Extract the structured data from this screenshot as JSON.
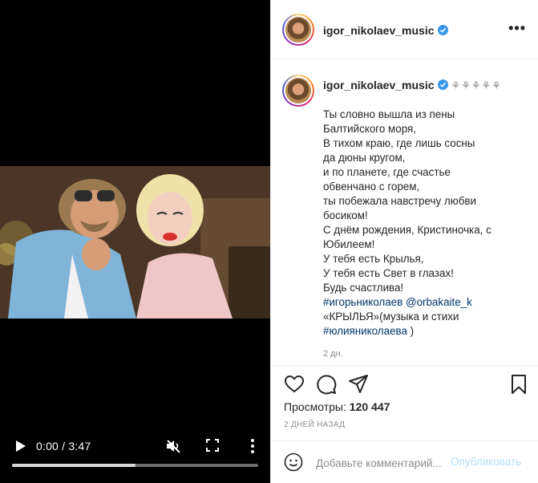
{
  "video": {
    "time_current": "0:00",
    "time_total": "3:47",
    "progress": 0.5,
    "icons": [
      "play-icon",
      "muted-speaker-icon",
      "fullscreen-icon",
      "more-vertical-icon"
    ]
  },
  "header": {
    "username": "igor_nikolaev_music",
    "more_label": "•••"
  },
  "post": {
    "username": "igor_nikolaev_music",
    "flowers": "⚘⚘⚘⚘⚘",
    "caption_lines": [
      "Ты словно вышла из пены",
      "Балтийского моря,",
      "В тихом краю, где лишь сосны",
      "да дюны кругом,",
      "и по планете, где счастье",
      "обвенчано с горем,",
      "ты побежала навстречу любви",
      "босиком!",
      "С днём рождения, Кристиночка, с",
      "Юбилеем!",
      "У тебя есть Крылья,",
      "У тебя есть Свет в глазах!",
      "Будь счастлива!"
    ],
    "hashtag_1": "#игорьниколаев",
    "mention": "@orbakaite_k",
    "credits_text": "«КРЫЛЬЯ»(музыка и стихи",
    "hashtag_2": "#юлияниколаева",
    "credits_close": " )",
    "age": "2 дн."
  },
  "actions": {
    "views_label": "Просмотры:",
    "views_count": "120 447",
    "timestamp": "2 ДНЕЙ НАЗАД"
  },
  "comment": {
    "placeholder": "Добавьте комментарий...",
    "publish_label": "Опубликовать"
  },
  "colors": {
    "link": "#00376b",
    "verified": "#3897f0",
    "publish_disabled": "#b2dffc",
    "muted_text": "#8e8e8e"
  }
}
